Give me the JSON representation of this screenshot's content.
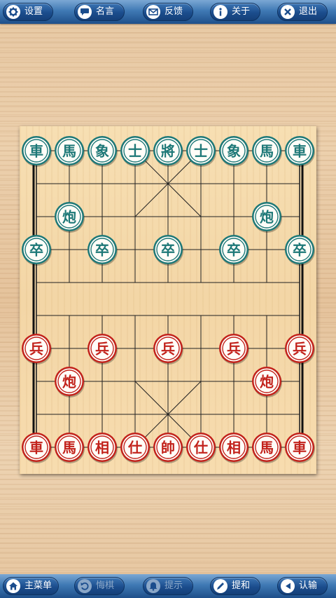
{
  "top_bar": {
    "buttons": [
      {
        "label": "设置",
        "icon": "gear-icon"
      },
      {
        "label": "名言",
        "icon": "speech-bubble-icon"
      },
      {
        "label": "反馈",
        "icon": "envelope-icon"
      },
      {
        "label": "关于",
        "icon": "info-icon"
      },
      {
        "label": "退出",
        "icon": "close-icon"
      }
    ]
  },
  "bottom_bar": {
    "buttons": [
      {
        "label": "主菜单",
        "icon": "home-icon",
        "enabled": true
      },
      {
        "label": "悔棋",
        "icon": "undo-icon",
        "enabled": false
      },
      {
        "label": "提示",
        "icon": "bell-icon",
        "enabled": false
      },
      {
        "label": "提和",
        "icon": "pencil-icon",
        "enabled": true
      },
      {
        "label": "认输",
        "icon": "flag-icon",
        "enabled": true
      }
    ]
  },
  "colors": {
    "black_side": "#1d7877",
    "red_side": "#c2221b",
    "board": "#f5d9aa",
    "bar": "#2b5f9c"
  },
  "board": {
    "pieces": [
      {
        "char": "車",
        "side": "black",
        "col": 0,
        "row": 0
      },
      {
        "char": "馬",
        "side": "black",
        "col": 1,
        "row": 0
      },
      {
        "char": "象",
        "side": "black",
        "col": 2,
        "row": 0
      },
      {
        "char": "士",
        "side": "black",
        "col": 3,
        "row": 0
      },
      {
        "char": "將",
        "side": "black",
        "col": 4,
        "row": 0
      },
      {
        "char": "士",
        "side": "black",
        "col": 5,
        "row": 0
      },
      {
        "char": "象",
        "side": "black",
        "col": 6,
        "row": 0
      },
      {
        "char": "馬",
        "side": "black",
        "col": 7,
        "row": 0
      },
      {
        "char": "車",
        "side": "black",
        "col": 8,
        "row": 0
      },
      {
        "char": "炮",
        "side": "black",
        "col": 1,
        "row": 2
      },
      {
        "char": "炮",
        "side": "black",
        "col": 7,
        "row": 2
      },
      {
        "char": "卒",
        "side": "black",
        "col": 0,
        "row": 3
      },
      {
        "char": "卒",
        "side": "black",
        "col": 2,
        "row": 3
      },
      {
        "char": "卒",
        "side": "black",
        "col": 4,
        "row": 3
      },
      {
        "char": "卒",
        "side": "black",
        "col": 6,
        "row": 3
      },
      {
        "char": "卒",
        "side": "black",
        "col": 8,
        "row": 3
      },
      {
        "char": "兵",
        "side": "red",
        "col": 0,
        "row": 6
      },
      {
        "char": "兵",
        "side": "red",
        "col": 2,
        "row": 6
      },
      {
        "char": "兵",
        "side": "red",
        "col": 4,
        "row": 6
      },
      {
        "char": "兵",
        "side": "red",
        "col": 6,
        "row": 6
      },
      {
        "char": "兵",
        "side": "red",
        "col": 8,
        "row": 6
      },
      {
        "char": "炮",
        "side": "red",
        "col": 1,
        "row": 7
      },
      {
        "char": "炮",
        "side": "red",
        "col": 7,
        "row": 7
      },
      {
        "char": "車",
        "side": "red",
        "col": 0,
        "row": 9
      },
      {
        "char": "馬",
        "side": "red",
        "col": 1,
        "row": 9
      },
      {
        "char": "相",
        "side": "red",
        "col": 2,
        "row": 9
      },
      {
        "char": "仕",
        "side": "red",
        "col": 3,
        "row": 9
      },
      {
        "char": "帥",
        "side": "red",
        "col": 4,
        "row": 9
      },
      {
        "char": "仕",
        "side": "red",
        "col": 5,
        "row": 9
      },
      {
        "char": "相",
        "side": "red",
        "col": 6,
        "row": 9
      },
      {
        "char": "馬",
        "side": "red",
        "col": 7,
        "row": 9
      },
      {
        "char": "車",
        "side": "red",
        "col": 8,
        "row": 9
      }
    ]
  }
}
